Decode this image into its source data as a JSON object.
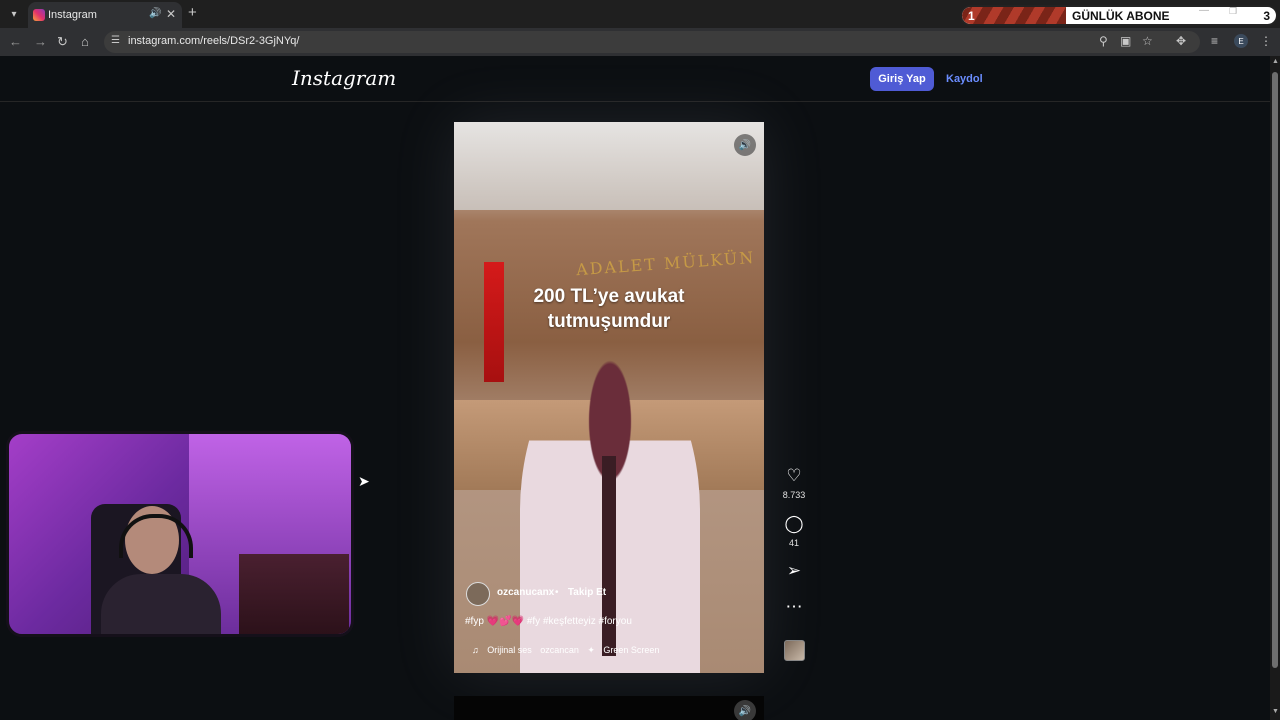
{
  "browser": {
    "tab_title": "Instagram",
    "url": "instagram.com/reels/DSr2-3GjNYq/",
    "icons": [
      "tab-list-icon",
      "audio-icon",
      "close-icon",
      "plus-icon",
      "back-icon",
      "forward-icon",
      "reload-icon",
      "home-icon",
      "site-info-icon",
      "zoom-icon",
      "install-icon",
      "star-icon",
      "extensions-icon",
      "media-icon",
      "profile-avatar",
      "kebab-menu-icon"
    ],
    "profile_initial": "E"
  },
  "subscriber_widget": {
    "start": "1",
    "label": "GÜNLÜK ABONE",
    "goal": "3",
    "progress_fraction": 0.33,
    "colors": {
      "fill": "#b03a2a",
      "background": "#ffffff"
    }
  },
  "instagram": {
    "logo": "Instagram",
    "login_label": "Giriş Yap",
    "signup_label": "Kaydol",
    "colors": {
      "login_button": "#4f5bd5",
      "signup_link": "#6b8dff"
    }
  },
  "reel": {
    "caption_line1": "200 TL’ye avukat",
    "caption_line2": "tutmuşumdur",
    "author": "ozcanucanx",
    "separator": "•",
    "follow_label": "Takip Et",
    "hashtags_pre": "#fyp",
    "hearts": "💗💕💗",
    "hashtags_post": "#fy #keşfetteyiz #foryou",
    "audio_label": "Orijinal ses",
    "audio_author": "ozcancan",
    "effect_label": "Green Screen",
    "likes": "8.733",
    "comments": "41"
  }
}
